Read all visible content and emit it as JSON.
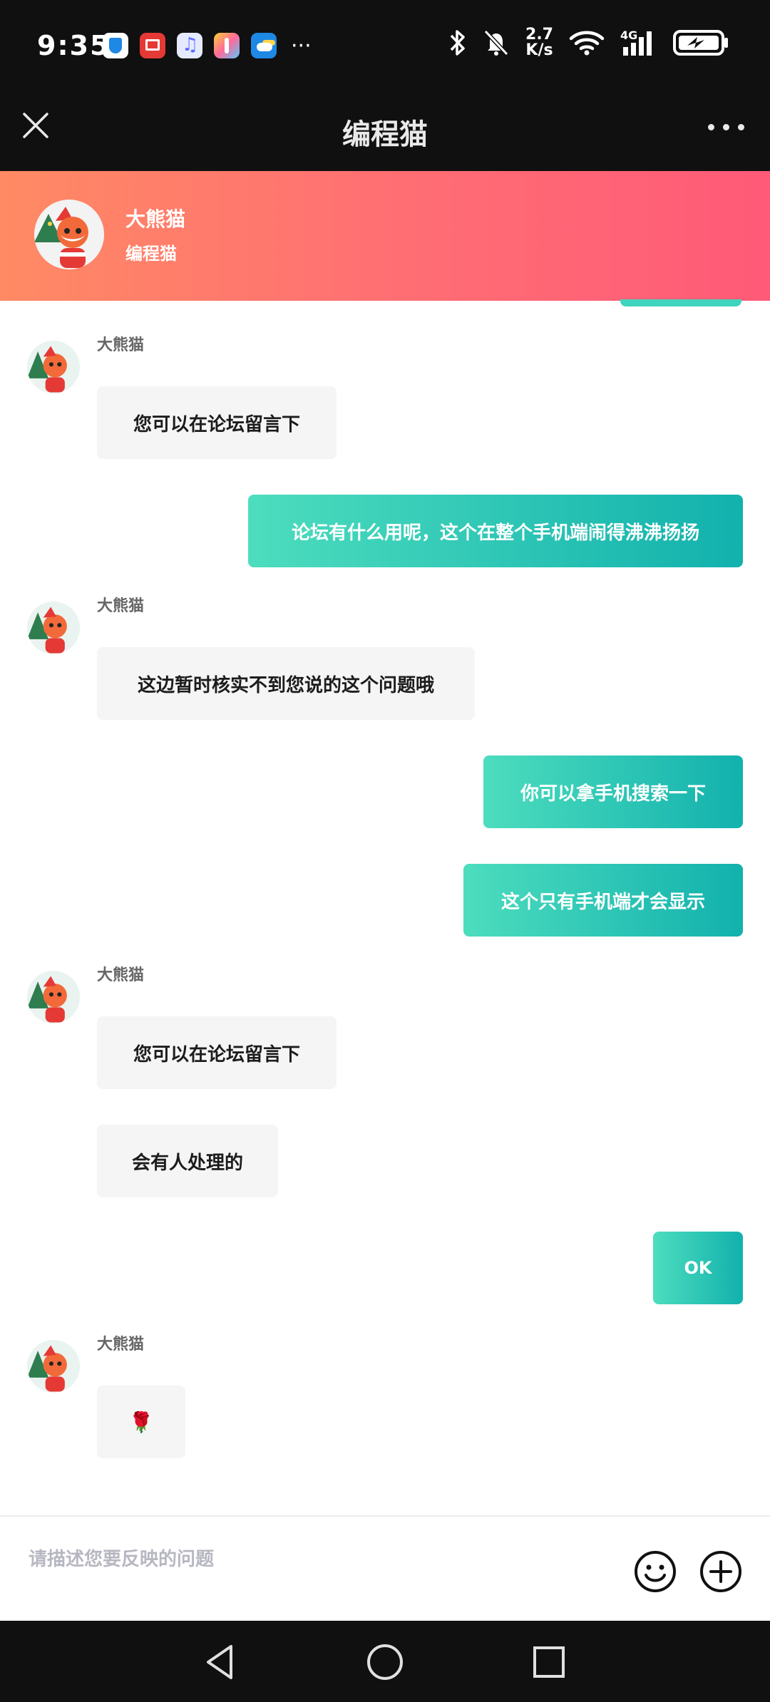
{
  "status_bar": {
    "time": "9:35",
    "app_icons": [
      "shield-app-icon",
      "book-app-icon",
      "music-app-icon",
      "brush-app-icon",
      "weather-app-icon"
    ],
    "more": "···",
    "speed_value": "2.7",
    "speed_unit": "K/s",
    "network": "4G",
    "icons": [
      "bluetooth-icon",
      "bell-muted-icon",
      "wifi-icon",
      "signal-icon",
      "battery-charging-icon"
    ]
  },
  "header": {
    "title": "编程猫"
  },
  "banner": {
    "name": "大熊猫",
    "subtitle": "编程猫"
  },
  "messages": [
    {
      "side": "in",
      "sender": "大熊猫",
      "text": "您可以在论坛留言下"
    },
    {
      "side": "out",
      "text": "论坛有什么用呢，这个在整个手机端闹得沸沸扬扬"
    },
    {
      "side": "in",
      "sender": "大熊猫",
      "text": "这边暂时核实不到您说的这个问题哦"
    },
    {
      "side": "out",
      "text": "你可以拿手机搜索一下"
    },
    {
      "side": "out",
      "text": "这个只有手机端才会显示"
    },
    {
      "side": "in",
      "sender": "大熊猫",
      "text": "您可以在论坛留言下"
    },
    {
      "side": "in",
      "text": "会有人处理的"
    },
    {
      "side": "out",
      "text": "OK"
    },
    {
      "side": "in",
      "sender": "大熊猫",
      "text": "🌹"
    }
  ],
  "input": {
    "placeholder": "请描述您要反映的问题",
    "value": ""
  },
  "colors": {
    "banner_start": "#ff8a64",
    "banner_end": "#ff5a78",
    "outgoing_start": "#4dddbe",
    "outgoing_end": "#12b1ad",
    "incoming_bg": "#f5f5f5",
    "bar_bg": "#101010"
  }
}
